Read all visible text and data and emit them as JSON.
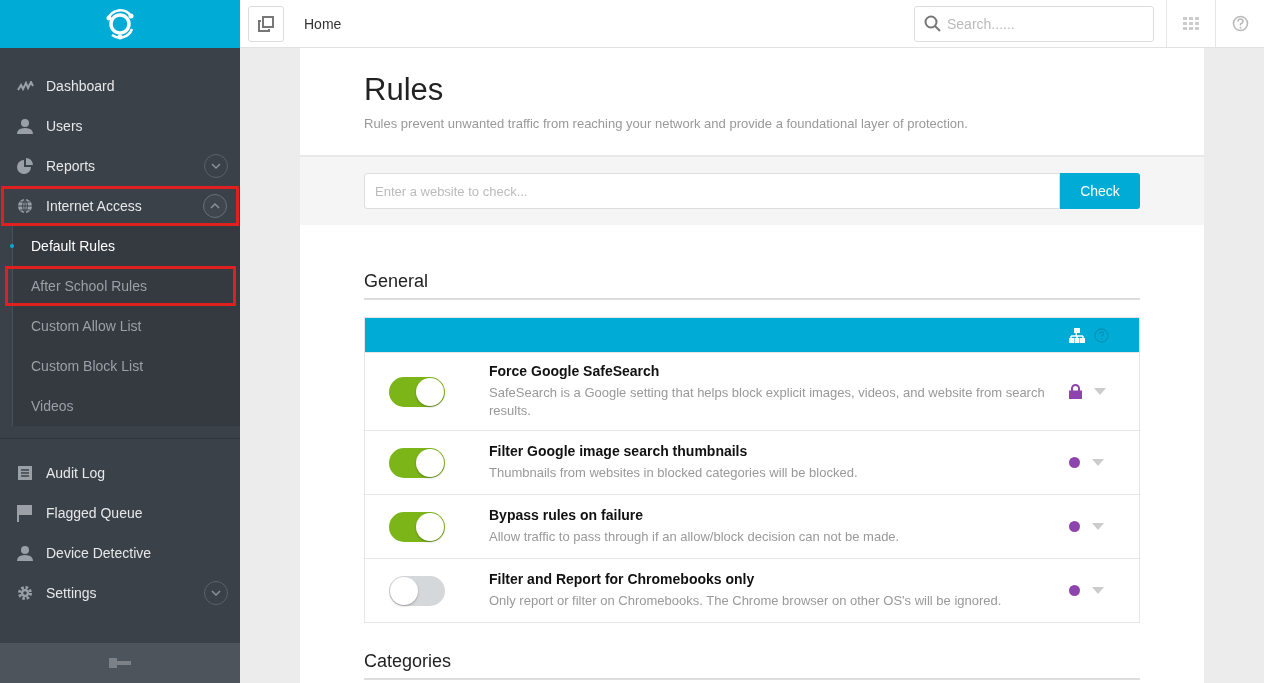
{
  "topbar": {
    "breadcrumb": "Home",
    "search": {
      "placeholder": "Search......"
    }
  },
  "sidebar": {
    "items": [
      {
        "label": "Dashboard",
        "kind": "chart",
        "highlighted": false
      },
      {
        "label": "Users",
        "kind": "user",
        "highlighted": false
      },
      {
        "label": "Reports",
        "kind": "pie",
        "expanded": false,
        "highlighted": false
      },
      {
        "label": "Internet Access",
        "kind": "globe",
        "expanded": true,
        "highlighted": true,
        "children": [
          {
            "label": "Default Rules",
            "selected": true,
            "highlighted": false
          },
          {
            "label": "After School Rules",
            "selected": false,
            "highlighted": true
          },
          {
            "label": "Custom Allow List",
            "selected": false,
            "highlighted": false
          },
          {
            "label": "Custom Block List",
            "selected": false,
            "highlighted": false
          },
          {
            "label": "Videos",
            "selected": false,
            "highlighted": false
          }
        ]
      }
    ],
    "lower_items": [
      {
        "label": "Audit Log",
        "kind": "log",
        "highlighted": false
      },
      {
        "label": "Flagged Queue",
        "kind": "flag",
        "highlighted": false
      },
      {
        "label": "Device Detective",
        "kind": "user",
        "highlighted": false
      },
      {
        "label": "Settings",
        "kind": "gear",
        "expanded": false,
        "highlighted": false
      }
    ]
  },
  "page": {
    "title": "Rules",
    "subtitle": "Rules prevent unwanted traffic from reaching your network and provide a foundational layer of protection.",
    "check": {
      "placeholder": "Enter a website to check...",
      "button": "Check"
    },
    "sections": [
      {
        "heading": "General",
        "rules": [
          {
            "title": "Force Google SafeSearch",
            "description": "SafeSearch is a Google setting that helps block explicit images, videos, and website from search results.",
            "on": true,
            "kind": "lock"
          },
          {
            "title": "Filter Google image search thumbnails",
            "description": "Thumbnails from websites in blocked categories will be blocked.",
            "on": true,
            "kind": "dot"
          },
          {
            "title": "Bypass rules on failure",
            "description": "Allow traffic to pass through if an allow/block decision can not be made.",
            "on": true,
            "kind": "dot"
          },
          {
            "title": "Filter and Report for Chromebooks only",
            "description": "Only report or filter on Chromebooks. The Chrome browser on other OS's will be ignored.",
            "on": false,
            "kind": "dot"
          }
        ]
      },
      {
        "heading": "Categories"
      }
    ]
  }
}
